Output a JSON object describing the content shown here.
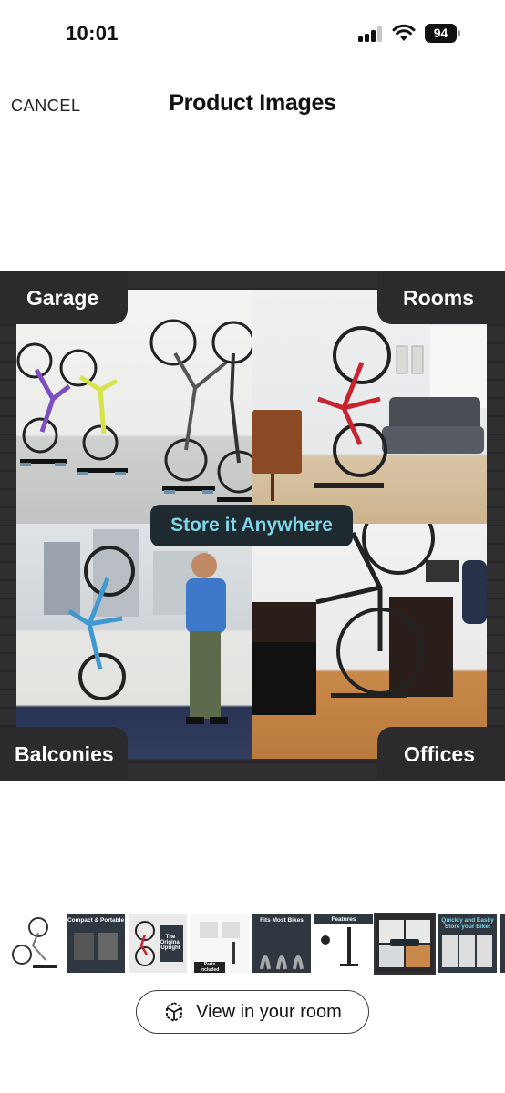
{
  "status_bar": {
    "time": "10:01",
    "battery": "94",
    "signal_bars_active": 3,
    "signal_bars_total": 4
  },
  "nav": {
    "cancel_label": "CANCEL",
    "title": "Product Images"
  },
  "main_image": {
    "labels": {
      "top_left": "Garage",
      "top_right": "Rooms",
      "bottom_left": "Balconies",
      "bottom_right": "Offices"
    },
    "center_text": "Store it Anywhere",
    "colors": {
      "frame": "#2b2b2d",
      "center_text": "#7fd6e8"
    }
  },
  "thumbnails": [
    {
      "icon": "bike-stand-photo",
      "caption": ""
    },
    {
      "icon": "compact-portable",
      "caption": "Compact & Portable"
    },
    {
      "icon": "original-upright",
      "caption": "The Original Upright"
    },
    {
      "icon": "parts-included",
      "caption": "Parts Included"
    },
    {
      "icon": "fits-most-bikes",
      "caption": "Fits Most Bikes"
    },
    {
      "icon": "features",
      "caption": "Features"
    },
    {
      "icon": "store-it-anywhere",
      "caption": "Store it Anywhere",
      "selected": true
    },
    {
      "icon": "quickly-easily",
      "caption": "Quickly and Easily Store your Bike!"
    },
    {
      "icon": "more-thumbnail",
      "caption": ""
    }
  ],
  "view_in_room": {
    "label": "View in your room",
    "icon": "ar-cube-icon"
  }
}
